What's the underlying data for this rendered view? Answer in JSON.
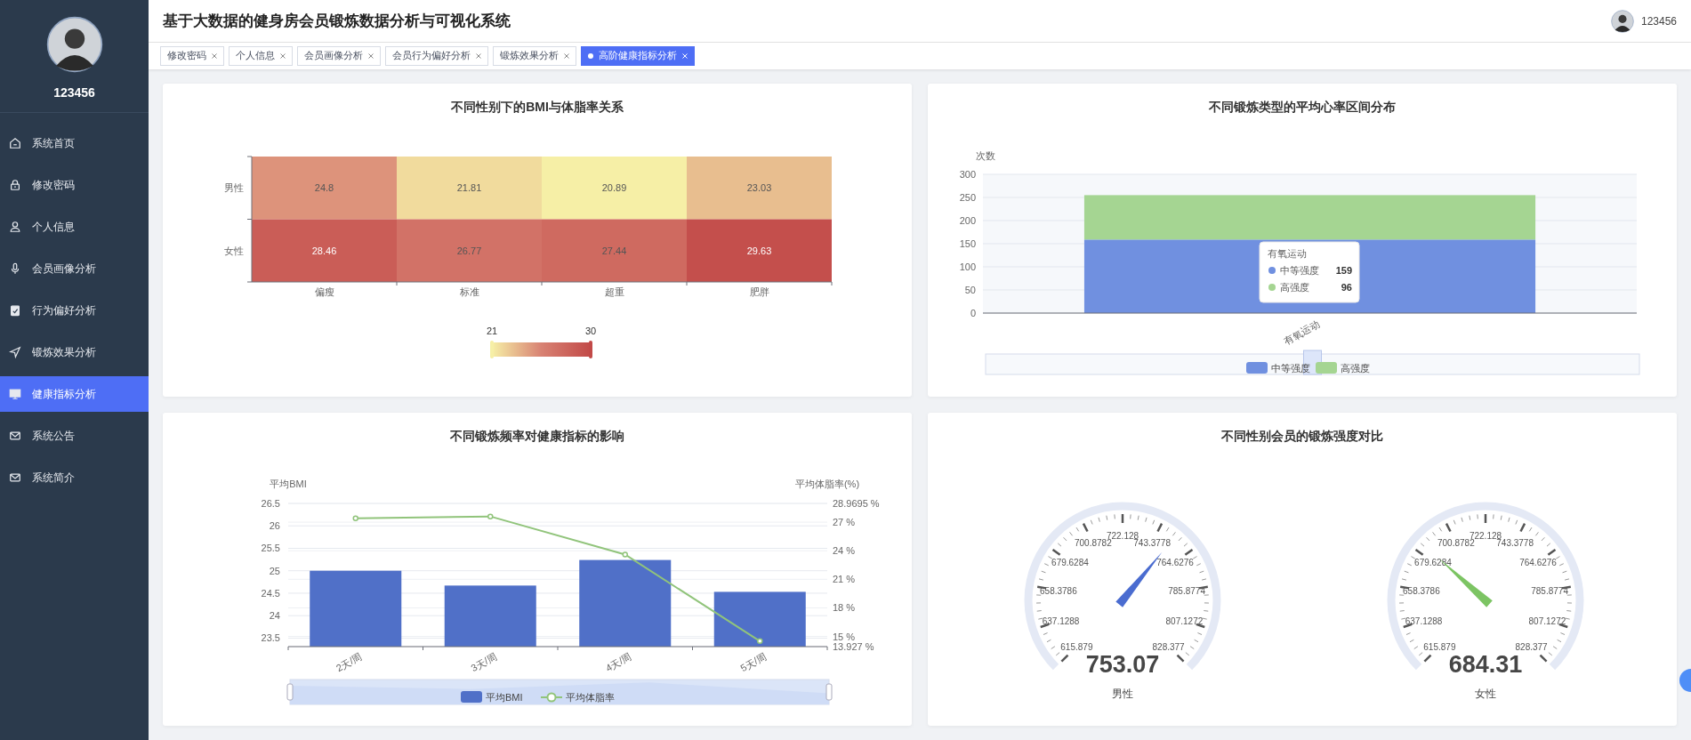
{
  "sidebar": {
    "username": "123456",
    "items": [
      {
        "label": "系统首页",
        "selected": false
      },
      {
        "label": "修改密码",
        "selected": false
      },
      {
        "label": "个人信息",
        "selected": false
      },
      {
        "label": "会员画像分析",
        "selected": false
      },
      {
        "label": "行为偏好分析",
        "selected": false
      },
      {
        "label": "锻炼效果分析",
        "selected": false
      },
      {
        "label": "健康指标分析",
        "selected": true
      },
      {
        "label": "系统公告",
        "selected": false
      },
      {
        "label": "系统简介",
        "selected": false
      }
    ]
  },
  "header": {
    "title": "基于大数据的健身房会员锻炼数据分析与可视化系统",
    "username": "123456"
  },
  "tabs": [
    {
      "label": "修改密码",
      "selected": false
    },
    {
      "label": "个人信息",
      "selected": false
    },
    {
      "label": "会员画像分析",
      "selected": false
    },
    {
      "label": "会员行为偏好分析",
      "selected": false
    },
    {
      "label": "锻炼效果分析",
      "selected": false
    },
    {
      "label": "高阶健康指标分析",
      "selected": true
    }
  ],
  "panels": [
    {
      "kind": "heatmap",
      "title": "不同性别下的BMI与体脂率关系",
      "rows": [
        "男性",
        "女性"
      ],
      "columns": [
        "偏瘦",
        "标准",
        "超重",
        "肥胖"
      ],
      "cells": [
        [
          "24.8",
          "21.81",
          "20.89",
          "23.03"
        ],
        [
          "28.46",
          "26.77",
          "27.44",
          "29.63"
        ]
      ],
      "scale_min": "21",
      "scale_max": "30"
    },
    {
      "kind": "stacked_bar",
      "title": "不同锻炼类型的平均心率区间分布",
      "chart_data": {
        "type": "bar",
        "stacked": true,
        "ylabel": "次数",
        "categories": [
          "有氧运动"
        ],
        "series": [
          {
            "name": "中等强度",
            "color": "#7090e0",
            "values": [
              159
            ]
          },
          {
            "name": "高强度",
            "color": "#a5d592",
            "values": [
              96
            ]
          }
        ],
        "ylim": [
          0,
          300
        ],
        "yticks": [
          0,
          50,
          100,
          150,
          200,
          250,
          300
        ],
        "grid": true,
        "legend": true
      },
      "tooltip": {
        "title": "有氧运动",
        "rows": [
          {
            "label": "中等强度",
            "value": "159"
          },
          {
            "label": "高强度",
            "value": "96"
          }
        ]
      }
    },
    {
      "kind": "combo",
      "title": "不同锻炼频率对健康指标的影响",
      "chart_data": {
        "type": "bar",
        "ylabel": "平均BMI",
        "y2label": "平均体脂率(%)",
        "categories": [
          "2天/周",
          "3天/周",
          "4天/周",
          "5天/周"
        ],
        "series": [
          {
            "name": "平均BMI",
            "type": "bar",
            "color": "#5070c8",
            "values": [
              25.0,
              24.67,
              25.24,
              24.53
            ]
          },
          {
            "name": "平均体脂率",
            "type": "line",
            "axis": "y2",
            "marker": "circle",
            "color": "#91c47b",
            "values": [
              27.4,
              27.6,
              23.6,
              14.5
            ]
          }
        ],
        "grid": true,
        "legend": true,
        "ylim": [
          23.31,
          26.5
        ],
        "yticks": [
          23.5,
          24,
          24.5,
          25,
          25.5,
          26,
          26.5
        ],
        "y2lim": [
          13.927,
          28.9695
        ],
        "y2ticks": [
          {
            "value": 13.927,
            "label": "13.927 %"
          },
          {
            "value": 15,
            "label": "15 %"
          },
          {
            "value": 18,
            "label": "18 %"
          },
          {
            "value": 21,
            "label": "21 %"
          },
          {
            "value": 24,
            "label": "24 %"
          },
          {
            "value": 27,
            "label": "27 %"
          },
          {
            "value": 28.9695,
            "label": "28.9695 %"
          }
        ]
      }
    },
    {
      "kind": "gauges",
      "title": "不同性别会员的锻炼强度对比",
      "gauges": [
        {
          "label": "男性",
          "value": "753.07",
          "color": "#4a6cd0",
          "ticks": [
            "722.128",
            "700.8782",
            "743.3778",
            "679.6284",
            "764.6276",
            "658.3786",
            "785.8774",
            "637.1288",
            "807.1272",
            "615.879",
            "828.377"
          ]
        },
        {
          "label": "女性",
          "value": "684.31",
          "color": "#7cc463",
          "ticks": [
            "722.128",
            "700.8782",
            "743.3778",
            "679.6284",
            "764.6276",
            "658.3786",
            "785.8774",
            "637.1288",
            "807.1272",
            "615.879",
            "828.377"
          ]
        }
      ]
    }
  ]
}
